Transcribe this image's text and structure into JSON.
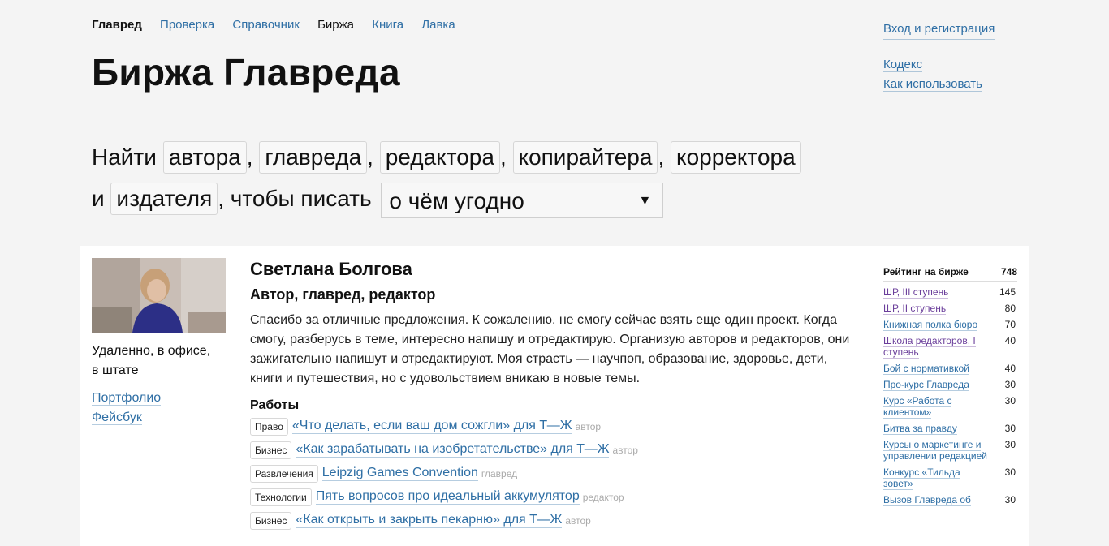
{
  "nav": {
    "brand": "Главред",
    "items": [
      "Проверка",
      "Справочник",
      "Биржа",
      "Книга",
      "Лавка"
    ],
    "current_index": 2
  },
  "account": {
    "login": "Вход и регистрация",
    "links": [
      "Кодекс",
      "Как использовать"
    ]
  },
  "page_title": "Биржа Главреда",
  "finder": {
    "find": "Найти",
    "roles": [
      "автора",
      "главреда",
      "редактора",
      "копирайтера",
      "корректора"
    ],
    "and": "и",
    "publisher": "издателя",
    "to_write": ", чтобы писать",
    "topic_selected": "о чём угодно",
    "arrow": "▼"
  },
  "profile": {
    "name": "Светлана Болгова",
    "roles": "Автор, главред, редактор",
    "work_format_line1": "Удаленно, в офисе,",
    "work_format_line2": "в штате",
    "links": [
      "Портфолио",
      "Фейсбук"
    ],
    "bio": "Спасибо за отличные предложения. К сожалению, не смогу сейчас взять еще один проект. Когда смогу, разберусь в теме, интересно напишу и отредактирую. Организую авторов и редакторов, они зажигательно напишут и отредактируют. Моя страсть — научпоп, образование, здоровье, дети, книги и путешествия, но с удовольствием вникаю в новые темы.",
    "works_title": "Работы",
    "works": [
      {
        "tag": "Право",
        "title": "«Что делать, если ваш дом сожгли» для Т—Ж",
        "role": "автор"
      },
      {
        "tag": "Бизнес",
        "title": "«Как зарабатывать на изобретательстве» для Т—Ж",
        "role": "автор"
      },
      {
        "tag": "Развлечения",
        "title": "Leipzig Games Convention",
        "role": "главред"
      },
      {
        "tag": "Технологии",
        "title": "Пять вопросов про идеальный аккумулятор",
        "role": "редактор"
      },
      {
        "tag": "Бизнес",
        "title": "«Как открыть и закрыть пекарню» для Т—Ж",
        "role": "автор"
      }
    ]
  },
  "rating": {
    "title": "Рейтинг на бирже",
    "total": "748",
    "items": [
      {
        "label": "ШР, III ступень",
        "value": "145"
      },
      {
        "label": "ШР, II ступень",
        "value": "80"
      },
      {
        "label": "Книжная полка бюро",
        "value": "70"
      },
      {
        "label": "Школа редакторов, I ступень",
        "value": "40"
      },
      {
        "label": "Бой с нормативкой",
        "value": "40"
      },
      {
        "label": "Про-курс Главреда",
        "value": "30"
      },
      {
        "label": "Курс «Работа с клиентом»",
        "value": "30"
      },
      {
        "label": "Битва за правду",
        "value": "30"
      },
      {
        "label": "Курсы о маркетинге и управлении редакцией",
        "value": "30"
      },
      {
        "label": "Конкурс «Тильда зовет»",
        "value": "30"
      },
      {
        "label": "Вызов Главреда об",
        "value": "30"
      }
    ]
  }
}
